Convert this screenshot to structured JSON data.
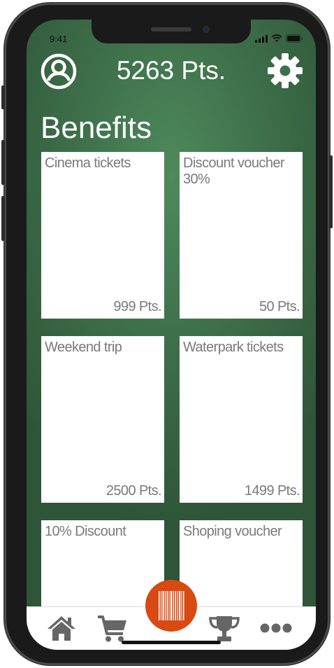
{
  "status_bar": {
    "time": "9:41"
  },
  "header": {
    "points": "5263 Pts."
  },
  "section": {
    "title": "Benefits"
  },
  "benefits": [
    {
      "title": "Cinema tickets",
      "points": "999 Pts."
    },
    {
      "title": "Discount voucher 30%",
      "points": "50 Pts."
    },
    {
      "title": "Weekend trip",
      "points": "2500 Pts."
    },
    {
      "title": "Waterpark tickets",
      "points": "1499 Pts."
    },
    {
      "title": "10% Discount",
      "points": ""
    },
    {
      "title": "Shoping voucher",
      "points": ""
    }
  ],
  "colors": {
    "background_green": "#3d6e49",
    "card": "#ffffff",
    "card_text": "#7a7a7a",
    "scan_button": "#d84a12",
    "tab_icon": "#666666"
  },
  "icons": {
    "profile": "user-circle-icon",
    "settings": "gear-icon",
    "home": "home-icon",
    "cart": "cart-icon",
    "scan": "barcode-icon",
    "rewards": "trophy-icon",
    "more": "more-dots-icon"
  }
}
